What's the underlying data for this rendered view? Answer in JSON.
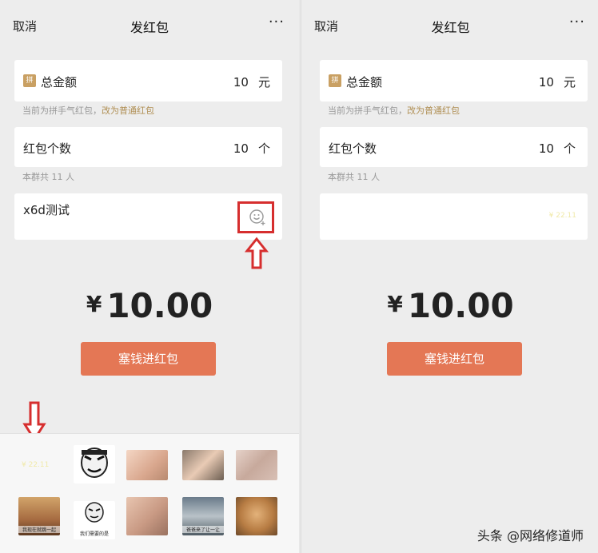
{
  "left": {
    "topbar": {
      "cancel": "取消",
      "title": "发红包",
      "more": "···"
    },
    "amount": {
      "badge": "拼",
      "label": "总金额",
      "value": "10",
      "unit": "元"
    },
    "amount_hint": {
      "prefix": "当前为拼手气红包，",
      "link": "改为普通红包"
    },
    "count": {
      "label": "红包个数",
      "value": "10",
      "unit": "个"
    },
    "count_hint": "本群共 11 人",
    "message": {
      "text": "x6d测试",
      "emoji_icon": "emoji-add-icon"
    },
    "big_amount": {
      "currency": "¥",
      "value": "10.00"
    },
    "send_button": "塞钱进红包",
    "stickers": {
      "faint_text": "¥ 22.11",
      "captions": [
        "我们需要的是",
        "爸爸来了让一让",
        "我现在就跳一起"
      ]
    }
  },
  "right": {
    "topbar": {
      "cancel": "取消",
      "title": "发红包",
      "more": "···"
    },
    "amount": {
      "badge": "拼",
      "label": "总金额",
      "value": "10",
      "unit": "元"
    },
    "amount_hint": {
      "prefix": "当前为拼手气红包，",
      "link": "改为普通红包"
    },
    "count": {
      "label": "红包个数",
      "value": "10",
      "unit": "个"
    },
    "count_hint": "本群共 11 人",
    "message": {
      "faint_text": "¥ 22.11"
    },
    "big_amount": {
      "currency": "¥",
      "value": "10.00"
    },
    "send_button": "塞钱进红包"
  },
  "watermark": "头条 @网络修道师",
  "colors": {
    "accent": "#e47755",
    "link": "#b08f54",
    "annotation": "#d62e2e",
    "badge": "#c9a063"
  }
}
